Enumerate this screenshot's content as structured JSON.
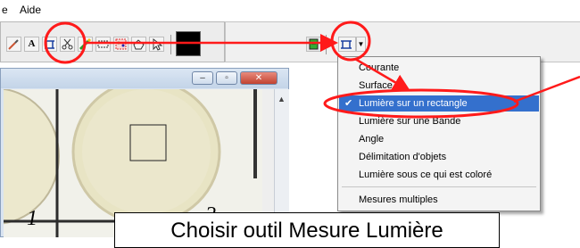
{
  "menubar": {
    "items": [
      "e",
      "Aide"
    ]
  },
  "toolbar": {
    "letter_tool": "A",
    "measure_button_tool": "🔒︎",
    "measure_dropdown_icon": "measure-light-icon"
  },
  "menu": {
    "items": [
      {
        "label": "Courante",
        "checked": false,
        "selected": false
      },
      {
        "label": "Surface",
        "checked": false,
        "selected": false
      },
      {
        "label": "Lumière sur un rectangle",
        "checked": true,
        "selected": true
      },
      {
        "label": "Lumière sur une Bande",
        "checked": false,
        "selected": false
      },
      {
        "label": "Angle",
        "checked": false,
        "selected": false
      },
      {
        "label": "Délimitation d'objets",
        "checked": false,
        "selected": false
      },
      {
        "label": "Lumière sous ce qui est coloré",
        "checked": false,
        "selected": false
      },
      {
        "label": "Mesures multiples",
        "checked": false,
        "selected": false
      }
    ]
  },
  "image": {
    "well_labels": [
      "1",
      "2"
    ]
  },
  "caption": {
    "text": "Choisir outil Mesure Lumière"
  },
  "colors": {
    "annotation": "#ff1a1a",
    "highlight": "#3470cd",
    "titlebar": "#c3d4e8"
  }
}
